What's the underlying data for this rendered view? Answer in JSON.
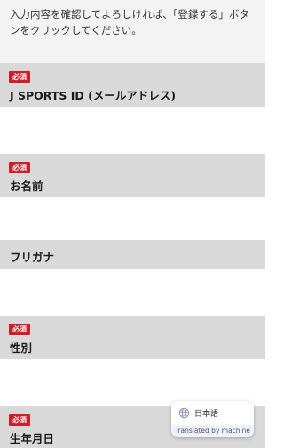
{
  "intro": {
    "line1": "入力内容を確認してよろしければ、「登録する」ボタ",
    "line2": "ンをクリックしてください。"
  },
  "required_badge": "必須",
  "fields": [
    {
      "label": "J SPORTS ID (メールアドレス)",
      "required": true
    },
    {
      "label": "お名前",
      "required": true
    },
    {
      "label": "フリガナ",
      "required": false
    },
    {
      "label": "性別",
      "required": true
    },
    {
      "label": "生年月日",
      "required": true
    }
  ],
  "translate_popup": {
    "language": "日本語",
    "translated_by": "Translated by machine",
    "icon": "globe-icon"
  },
  "colors": {
    "header_bg": "#d9d9d9",
    "intro_bg": "#f3f3f3",
    "badge_bg": "#d01d26"
  }
}
